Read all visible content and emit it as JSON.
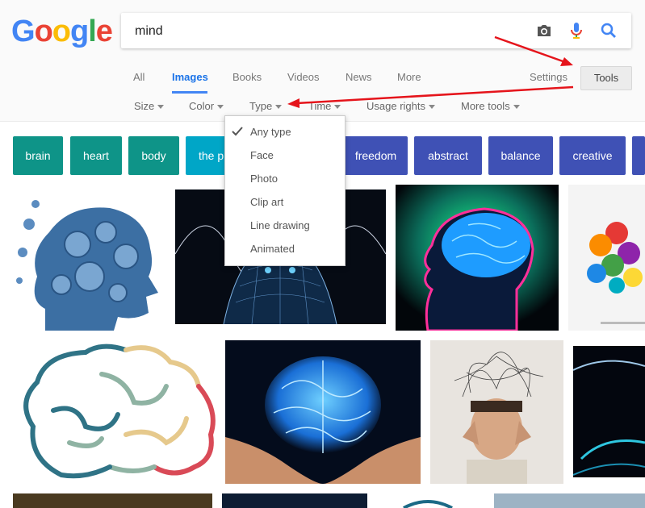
{
  "logo": {
    "letters": [
      "G",
      "o",
      "o",
      "g",
      "l",
      "e"
    ],
    "colors": [
      "#4285f4",
      "#ea4335",
      "#fbbc05",
      "#4285f4",
      "#34a853",
      "#ea4335"
    ]
  },
  "search": {
    "query": "mind",
    "icons": [
      "camera-icon",
      "microphone-icon",
      "search-icon"
    ]
  },
  "tabs": [
    "All",
    "Images",
    "Books",
    "Videos",
    "News",
    "More"
  ],
  "active_tab": "Images",
  "settings_label": "Settings",
  "tools_label": "Tools",
  "filters": [
    "Size",
    "Color",
    "Type",
    "Time",
    "Usage rights",
    "More tools"
  ],
  "chips": [
    {
      "label": "brain",
      "color": "#0e9488"
    },
    {
      "label": "heart",
      "color": "#0e9488"
    },
    {
      "label": "body",
      "color": "#0e9488"
    },
    {
      "label": "the p",
      "color": "#00a6c7"
    },
    {
      "label": "freedom",
      "color": "#3f51b5"
    },
    {
      "label": "abstract",
      "color": "#3f51b5"
    },
    {
      "label": "balance",
      "color": "#3f51b5"
    },
    {
      "label": "creative",
      "color": "#3f51b5"
    }
  ],
  "type_menu": {
    "selected": "Any type",
    "items": [
      "Any type",
      "Face",
      "Photo",
      "Clip art",
      "Line drawing",
      "Animated"
    ]
  },
  "annotation_color": "#e5141b"
}
